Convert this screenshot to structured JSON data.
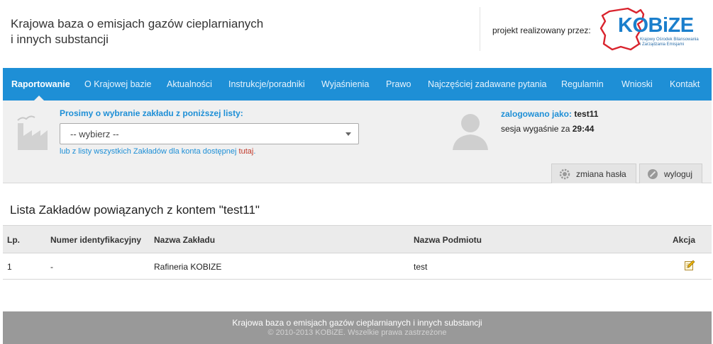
{
  "header": {
    "title_line1": "Krajowa baza o emisjach gazów cieplarnianych",
    "title_line2": "i innych substancji",
    "project_label": "projekt realizowany przez:",
    "logo_text": "KOBiZE",
    "logo_subtitle_line1": "Krajowy Ośrodek Bilansowania",
    "logo_subtitle_line2": "i Zarządzania Emisjami"
  },
  "nav": {
    "items": [
      {
        "label": "Raportowanie",
        "active": true
      },
      {
        "label": "O Krajowej bazie"
      },
      {
        "label": "Aktualności"
      },
      {
        "label": "Instrukcje/poradniki"
      },
      {
        "label": "Wyjaśnienia"
      },
      {
        "label": "Prawo"
      },
      {
        "label": "Najczęściej zadawane pytania"
      },
      {
        "label": "Regulamin"
      },
      {
        "label": "Wnioski"
      },
      {
        "label": "Kontakt"
      }
    ]
  },
  "facility_panel": {
    "prompt": "Prosimy o wybranie zakładu z poniższej listy:",
    "select_value": "-- wybierz --",
    "alt_text": "lub z listy wszystkich Zakładów dla konta dostępnej ",
    "alt_link": "tutaj",
    "alt_end": "."
  },
  "session": {
    "logged_label": "zalogowano jako:",
    "username": "test11",
    "expires_label": "sesja wygaśnie za",
    "expires_time": "29:44",
    "change_password": "zmiana hasła",
    "logout": "wyloguj"
  },
  "list": {
    "title": "Lista Zakładów powiązanych z kontem \"test11\"",
    "columns": [
      "Lp.",
      "Numer identyfikacyjny",
      "Nazwa Zakładu",
      "Nazwa Podmiotu",
      "Akcja"
    ],
    "rows": [
      {
        "lp": "1",
        "id_number": "-",
        "facility": "Rafineria KOBIZE",
        "entity": "test"
      }
    ]
  },
  "footer": {
    "line1": "Krajowa baza o emisjach gazów cieplarnianych i innych substancji",
    "line2": "© 2010-2013 KOBiZE. Wszelkie prawa zastrzeżone"
  },
  "colors": {
    "nav_blue": "#1e8fd6",
    "link_red": "#c0392b",
    "logo_red": "#d9232d",
    "footer_gray": "#999999"
  }
}
